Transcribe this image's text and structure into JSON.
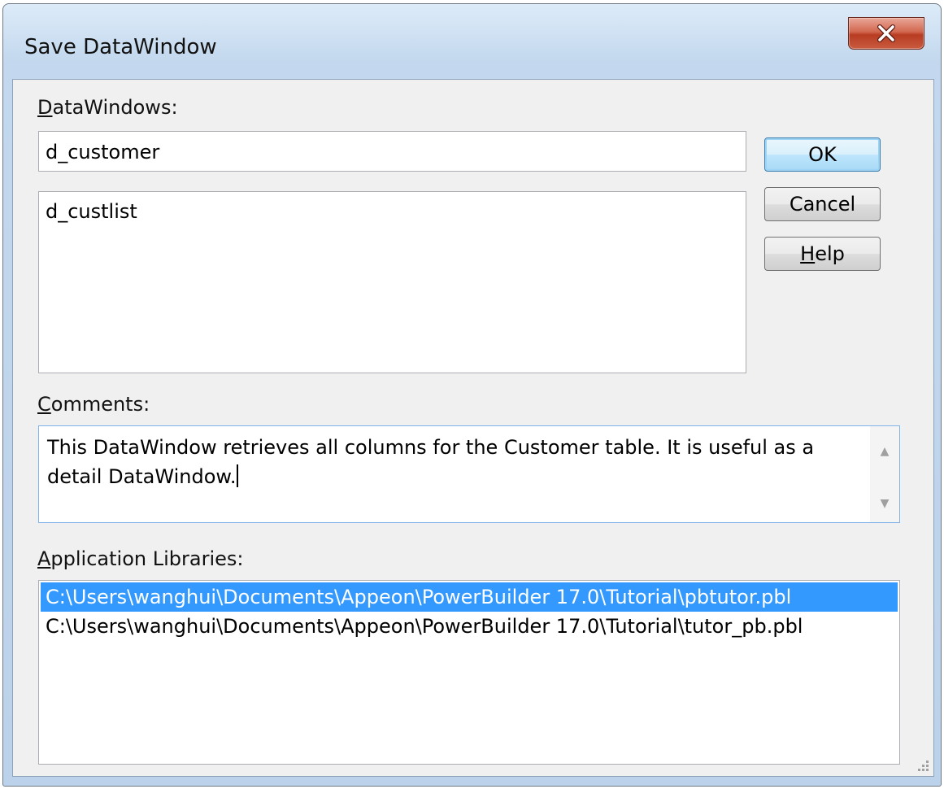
{
  "window": {
    "title": "Save DataWindow"
  },
  "form": {
    "datawindows_label_accel": "D",
    "datawindows_label_rest": "ataWindows:",
    "name_value": "d_customer",
    "existing_list": [
      "d_custlist"
    ],
    "comments_label_accel": "C",
    "comments_label_rest": "omments:",
    "comments_value": "This DataWindow retrieves all columns for the Customer table. It is useful as a detail DataWindow.",
    "libraries_label_accel": "A",
    "libraries_label_rest": "pplication Libraries:",
    "libraries": [
      "C:\\Users\\wanghui\\Documents\\Appeon\\PowerBuilder 17.0\\Tutorial\\pbtutor.pbl",
      "C:\\Users\\wanghui\\Documents\\Appeon\\PowerBuilder 17.0\\Tutorial\\tutor_pb.pbl"
    ],
    "selected_library_index": 0
  },
  "buttons": {
    "ok": "OK",
    "cancel": "Cancel",
    "help_accel": "H",
    "help_rest": "elp"
  },
  "icons": {
    "close": "close-x-icon",
    "scroll_up": "scroll-up-arrow-icon",
    "scroll_down": "scroll-down-arrow-icon",
    "resize_grip": "resize-grip-icon"
  },
  "colors": {
    "selection": "#3399ff",
    "close_button": "#c9523a",
    "default_button_border": "#3c7fb1"
  }
}
